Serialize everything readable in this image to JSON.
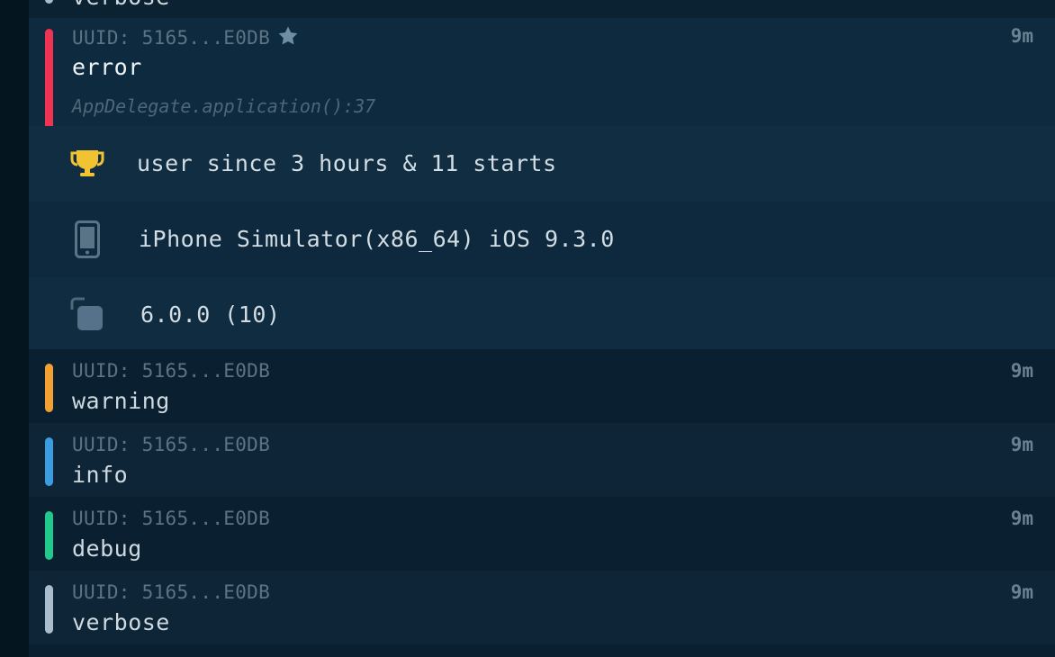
{
  "partial_entry": {
    "message": "verbose",
    "color": "#a9bccb"
  },
  "expanded_entry": {
    "uuid": "UUID: 5165...E0DB",
    "time": "9m",
    "message": "error",
    "location": "AppDelegate.application():37",
    "level_color": "#ee3452",
    "starred": true,
    "details": [
      {
        "icon": "trophy-icon",
        "text": "user since 3 hours & 11 starts"
      },
      {
        "icon": "phone-icon",
        "text": "iPhone Simulator(x86_64) iOS 9.3.0"
      },
      {
        "icon": "app-version-icon",
        "text": "6.0.0 (10)"
      }
    ]
  },
  "entries": [
    {
      "uuid": "UUID: 5165...E0DB",
      "time": "9m",
      "message": "warning",
      "level_color": "#f0a131"
    },
    {
      "uuid": "UUID: 5165...E0DB",
      "time": "9m",
      "message": "info",
      "level_color": "#3b9de0"
    },
    {
      "uuid": "UUID: 5165...E0DB",
      "time": "9m",
      "message": "debug",
      "level_color": "#22c98c"
    },
    {
      "uuid": "UUID: 5165...E0DB",
      "time": "9m",
      "message": "verbose",
      "level_color": "#a9bccb"
    }
  ]
}
